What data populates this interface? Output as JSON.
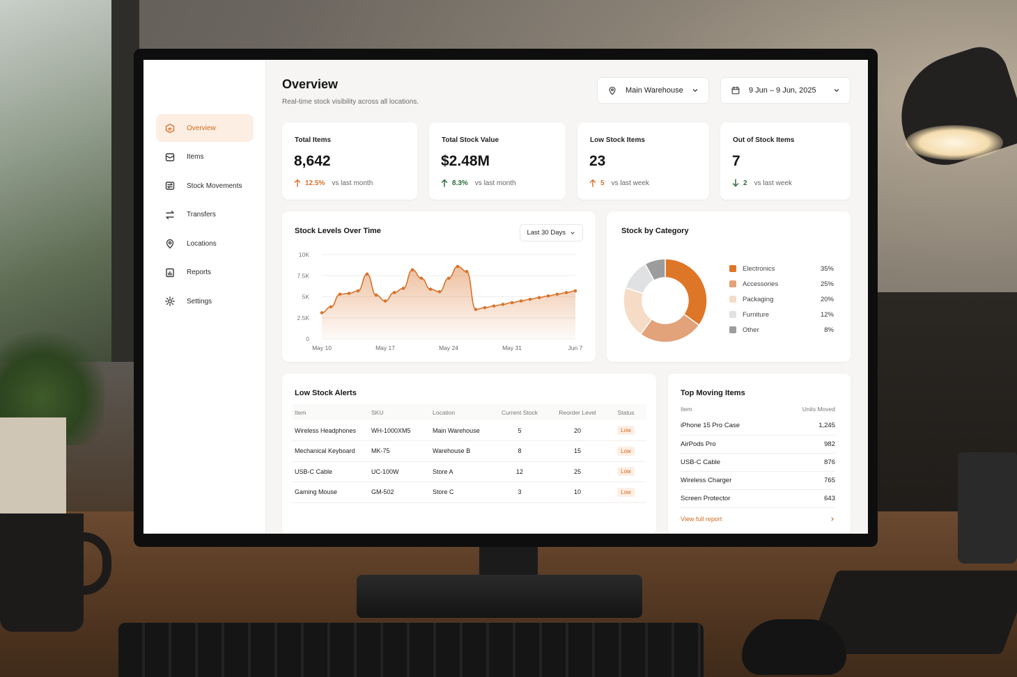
{
  "header": {
    "title": "Overview",
    "subtitle": "Real-time stock visibility across all locations.",
    "warehouse_select": "Main Warehouse",
    "date_range": "9 Jun – 9 Jun, 2025"
  },
  "sidebar": {
    "items": [
      {
        "label": "Overview",
        "icon": "box-icon",
        "active": true
      },
      {
        "label": "Items",
        "icon": "package-icon",
        "active": false
      },
      {
        "label": "Stock Movements",
        "icon": "movements-icon",
        "active": false
      },
      {
        "label": "Transfers",
        "icon": "transfers-icon",
        "active": false
      },
      {
        "label": "Locations",
        "icon": "map-pin-icon",
        "active": false
      },
      {
        "label": "Reports",
        "icon": "report-icon",
        "active": false
      },
      {
        "label": "Settings",
        "icon": "gear-icon",
        "active": false
      }
    ]
  },
  "kpis": [
    {
      "label": "Total Items",
      "value": "8,642",
      "delta": "12.5%",
      "direction": "up",
      "note": "vs last month",
      "color": "#d9722a"
    },
    {
      "label": "Total Stock Value",
      "value": "$2.48M",
      "delta": "8.3%",
      "direction": "up",
      "note": "vs last month",
      "color": "#2e6b3f"
    },
    {
      "label": "Low Stock Items",
      "value": "23",
      "delta": "5",
      "direction": "up",
      "note": "vs last week",
      "color": "#d9722a"
    },
    {
      "label": "Out of Stock Items",
      "value": "7",
      "delta": "2",
      "direction": "down",
      "note": "vs last week",
      "color": "#2e6b3f"
    }
  ],
  "stock_levels": {
    "title": "Stock Levels Over Time",
    "range_button": "Last 30 Days"
  },
  "chart_data": [
    {
      "type": "area",
      "title": "Stock Levels Over Time",
      "y_ticks": [
        "10K",
        "7.5K",
        "5K",
        "2.5K",
        "0"
      ],
      "ylim": [
        0,
        10000
      ],
      "x_tick_labels": [
        "May 10",
        "May 17",
        "May 24",
        "May 31",
        "Jun 7"
      ],
      "xlim": [
        0,
        28
      ],
      "x": [
        0,
        1,
        2,
        3,
        4,
        5,
        6,
        7,
        8,
        9,
        10,
        11,
        12,
        13,
        14,
        15,
        16,
        17,
        18,
        19,
        20,
        21,
        22,
        23,
        24,
        25,
        26,
        27,
        28
      ],
      "values": [
        3100,
        3800,
        5300,
        5400,
        5700,
        7700,
        5200,
        4500,
        5500,
        6000,
        8200,
        7200,
        5900,
        5600,
        7200,
        8600,
        8000,
        3500,
        3700,
        3900,
        4100,
        4300,
        4500,
        4700,
        4900,
        5100,
        5300,
        5500,
        5700
      ],
      "grid": true,
      "color": "#d9722a"
    },
    {
      "type": "pie",
      "title": "Stock by Category",
      "labels": [
        "Electronics",
        "Accessories",
        "Packaging",
        "Furniture",
        "Other"
      ],
      "values": [
        35,
        25,
        20,
        12,
        8
      ],
      "display": [
        "35%",
        "25%",
        "20%",
        "12%",
        "8%"
      ],
      "colors": [
        "#de7628",
        "#e2a27a",
        "#f6dcc6",
        "#dfe1e3",
        "#9c9c9c"
      ]
    }
  ],
  "category": {
    "title": "Stock by Category"
  },
  "low_stock": {
    "title": "Low Stock Alerts",
    "columns": [
      "Item",
      "SKU",
      "Location",
      "Current Stock",
      "Reorder Level",
      "Status"
    ],
    "rows": [
      {
        "item": "Wireless Headphones",
        "sku": "WH-1000XM5",
        "location": "Main Warehouse",
        "current": "5",
        "reorder": "20",
        "status": "Low"
      },
      {
        "item": "Mechanical Keyboard",
        "sku": "MK-75",
        "location": "Warehouse B",
        "current": "8",
        "reorder": "15",
        "status": "Low"
      },
      {
        "item": "USB-C Cable",
        "sku": "UC-100W",
        "location": "Store A",
        "current": "12",
        "reorder": "25",
        "status": "Low"
      },
      {
        "item": "Gaming Mouse",
        "sku": "GM-502",
        "location": "Store C",
        "current": "3",
        "reorder": "10",
        "status": "Low"
      }
    ]
  },
  "top_moving": {
    "title": "Top Moving Items",
    "columns": [
      "Item",
      "Units Moved"
    ],
    "rows": [
      {
        "item": "iPhone 15 Pro Case",
        "units": "1,245"
      },
      {
        "item": "AirPods Pro",
        "units": "982"
      },
      {
        "item": "USB-C Cable",
        "units": "876"
      },
      {
        "item": "Wireless Charger",
        "units": "765"
      },
      {
        "item": "Screen Protector",
        "units": "643"
      }
    ],
    "link": "View full report"
  }
}
